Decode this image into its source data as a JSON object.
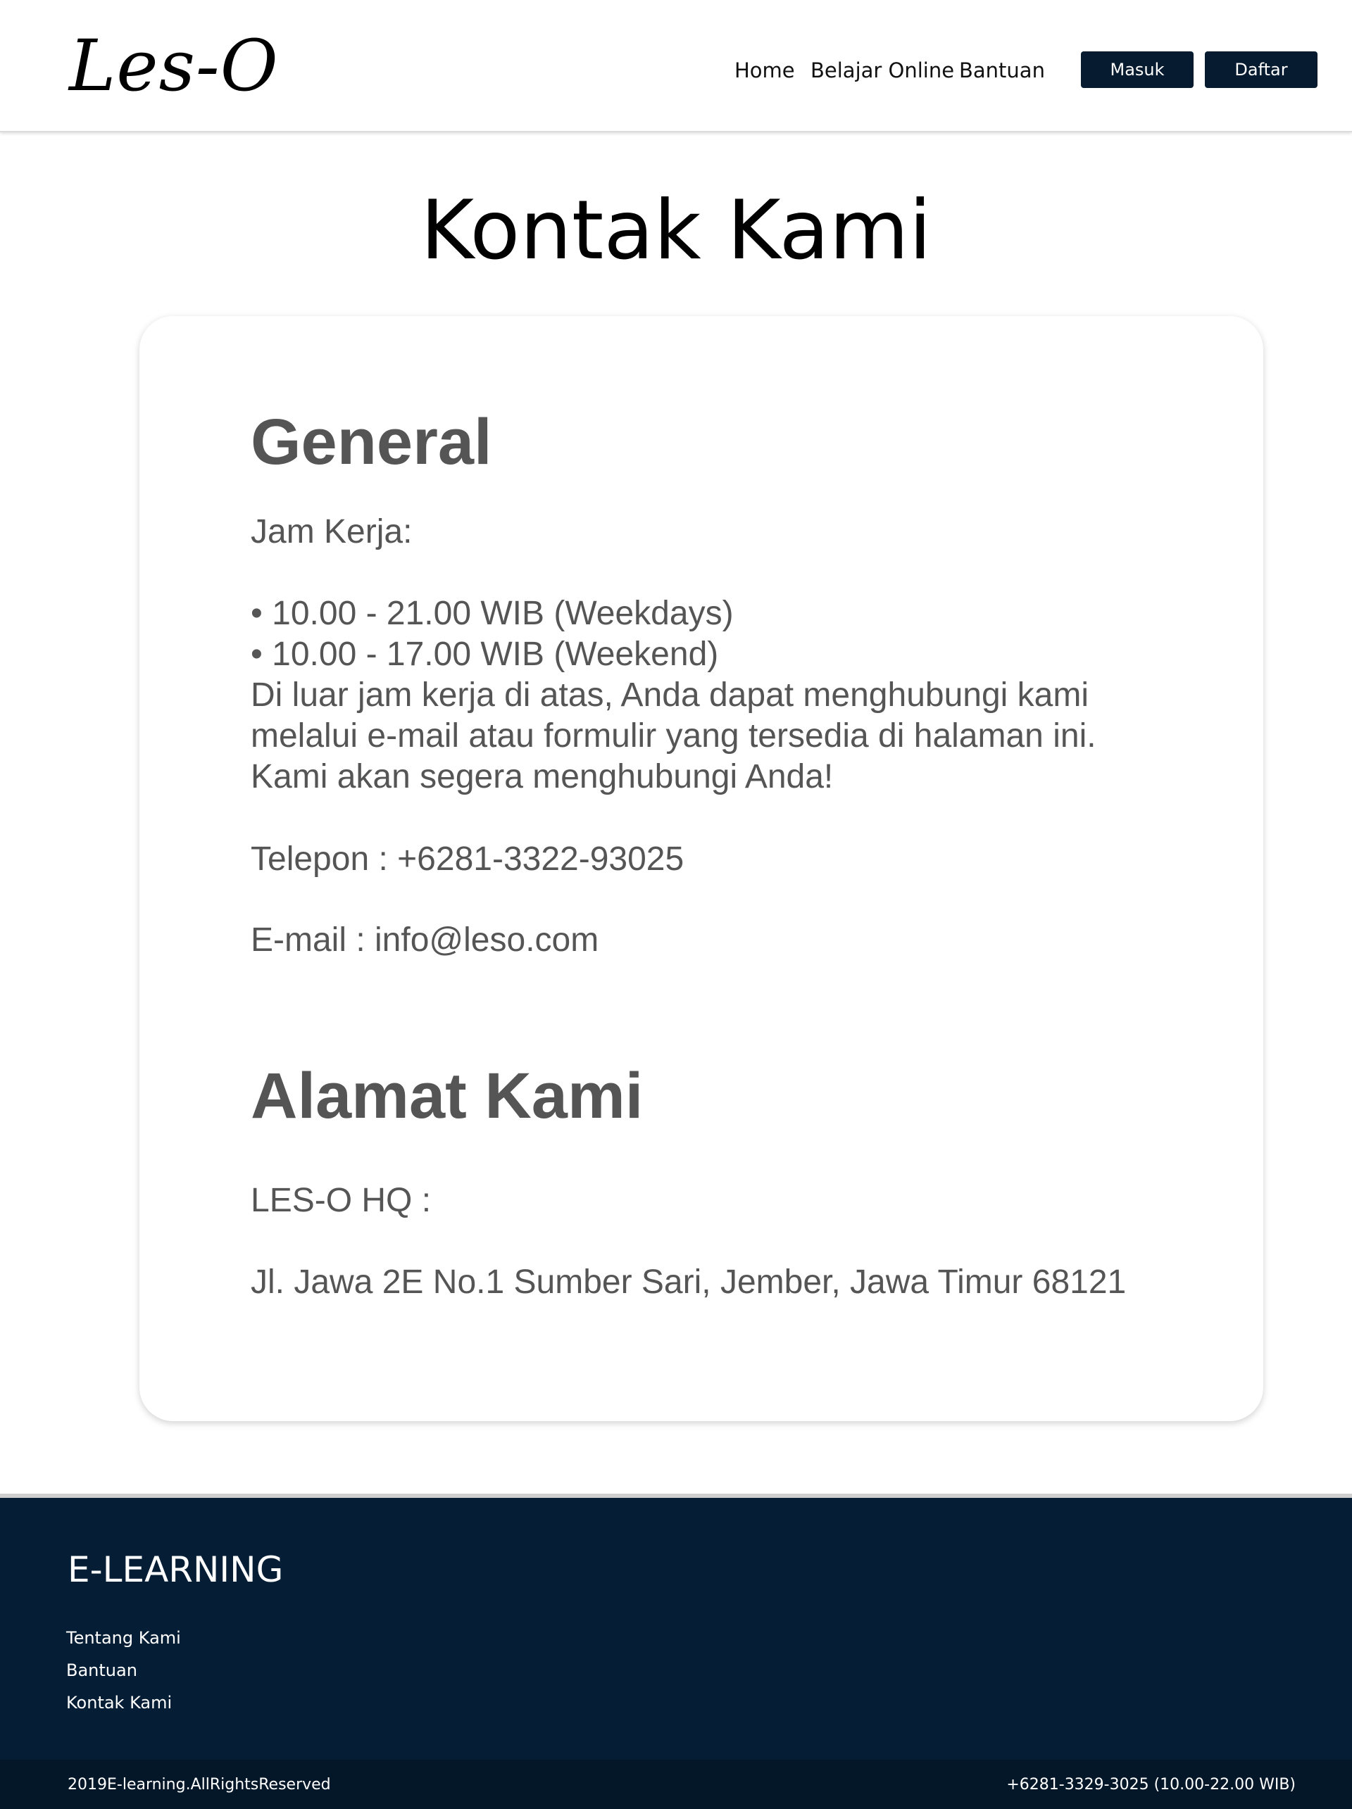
{
  "header": {
    "logo": "Les-O",
    "nav": {
      "home": "Home",
      "belajar_online": "Belajar Online",
      "bantuan": "Bantuan"
    },
    "buttons": {
      "masuk": "Masuk",
      "daftar": "Daftar"
    }
  },
  "page": {
    "title": "Kontak Kami"
  },
  "general": {
    "heading": "General",
    "jam_kerja_label": "Jam Kerja:",
    "hours": [
      "• 10.00 - 21.00 WIB (Weekdays)",
      "• 10.00 - 17.00 WIB (Weekend)"
    ],
    "note_lines": [
      "Di luar jam kerja di atas, Anda dapat menghubungi kami",
      "melalui e-mail atau formulir yang tersedia di halaman ini.",
      "Kami akan segera menghubungi Anda!"
    ],
    "telepon": "Telepon : +6281-3322-93025",
    "email": "E-mail : info@leso.com"
  },
  "alamat": {
    "heading": "Alamat Kami",
    "hq_label": "LES-O HQ :",
    "address": "Jl. Jawa 2E No.1 Sumber Sari, Jember, Jawa Timur 68121"
  },
  "footer": {
    "brand": "E-LEARNING",
    "links": [
      "Tentang Kami",
      "Bantuan",
      "Kontak Kami"
    ],
    "copyright": "2019E-learning.AllRightsReserved",
    "phone": "+6281-3329-3025 (10.00-22.00 WIB)"
  },
  "colors": {
    "navy": "#061b30",
    "footer_bg": "#051e35",
    "text_gray": "#555555"
  }
}
